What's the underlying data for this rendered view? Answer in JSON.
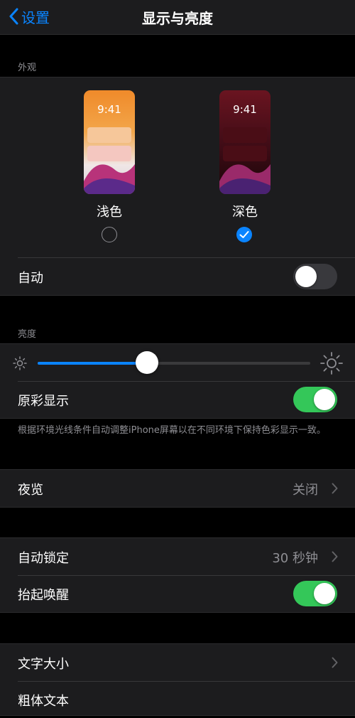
{
  "nav": {
    "back_label": "设置",
    "title": "显示与亮度"
  },
  "appearance": {
    "section_label": "外观",
    "light": {
      "time": "9:41",
      "label": "浅色",
      "selected": false
    },
    "dark": {
      "time": "9:41",
      "label": "深色",
      "selected": true
    },
    "auto_label": "自动",
    "auto_on": false
  },
  "brightness": {
    "section_label": "亮度",
    "level": 0.4,
    "true_tone_label": "原彩显示",
    "true_tone_on": true,
    "footnote": "根据环境光线条件自动调整iPhone屏幕以在不同环境下保持色彩显示一致。"
  },
  "night_shift": {
    "label": "夜览",
    "value": "关闭"
  },
  "lock": {
    "auto_lock_label": "自动锁定",
    "auto_lock_value": "30 秒钟",
    "raise_to_wake_label": "抬起唤醒",
    "raise_to_wake_on": true
  },
  "text": {
    "text_size_label": "文字大小",
    "bold_text_label": "粗体文本"
  },
  "colors": {
    "accent": "#0a84ff",
    "toggle_on": "#34c759",
    "toggle_off": "#39393d"
  }
}
